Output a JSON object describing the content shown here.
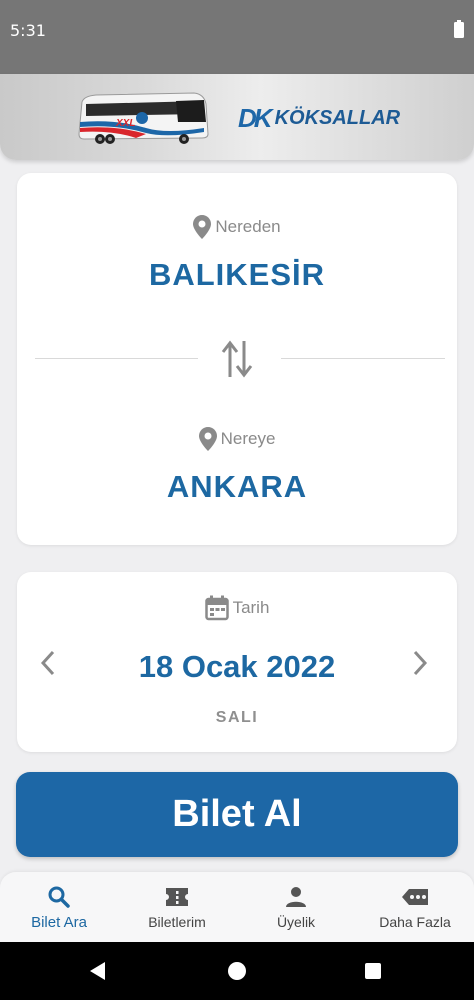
{
  "status_bar": {
    "time": "5:31"
  },
  "header": {
    "logo_mark": "DK",
    "logo_text": "KÖKSALLAR"
  },
  "route": {
    "from_label": "Nereden",
    "from_city": "BALIKESİR",
    "to_label": "Nereye",
    "to_city": "ANKARA"
  },
  "date": {
    "label": "Tarih",
    "value": "18 Ocak 2022",
    "day": "SALI"
  },
  "buy_button": {
    "label": "Bilet Al"
  },
  "bottom_nav": {
    "items": [
      {
        "label": "Bilet Ara",
        "icon": "search-icon",
        "active": true
      },
      {
        "label": "Biletlerim",
        "icon": "ticket-icon",
        "active": false
      },
      {
        "label": "Üyelik",
        "icon": "person-icon",
        "active": false
      },
      {
        "label": "Daha Fazla",
        "icon": "more-icon",
        "active": false
      }
    ]
  },
  "colors": {
    "primary": "#1d68a2",
    "status_bar": "#767676",
    "label_gray": "#8a8a8a"
  }
}
